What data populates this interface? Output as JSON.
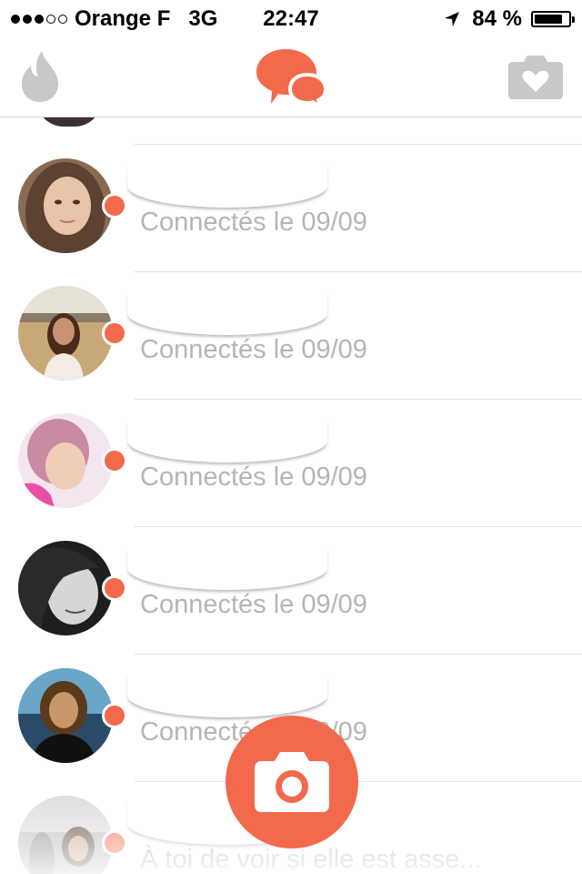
{
  "status_bar": {
    "carrier": "Orange F",
    "network": "3G",
    "time": "22:47",
    "battery": "84 %",
    "battery_level": 0.84,
    "signal_bars": 3
  },
  "nav": {
    "left_icon": "flame-icon",
    "center_icon": "chat-bubbles-icon",
    "right_icon": "camera-heart-icon"
  },
  "colors": {
    "accent": "#f26a4b",
    "icon_gray": "#c8c8c8",
    "muted_text": "#b5b5b5"
  },
  "conversations": [
    {
      "subtitle": "Connectés le 09/09",
      "unread": true
    },
    {
      "subtitle": "Connectés le 09/09",
      "unread": true
    },
    {
      "subtitle": "Connectés le 09/09",
      "unread": true
    },
    {
      "subtitle": "Connectés le 09/09",
      "unread": true
    },
    {
      "subtitle": "Connectés le 09/09",
      "unread": true
    },
    {
      "subtitle": "À toi de voir si elle est asse...",
      "unread": true
    }
  ],
  "fab": {
    "icon": "camera-icon"
  }
}
